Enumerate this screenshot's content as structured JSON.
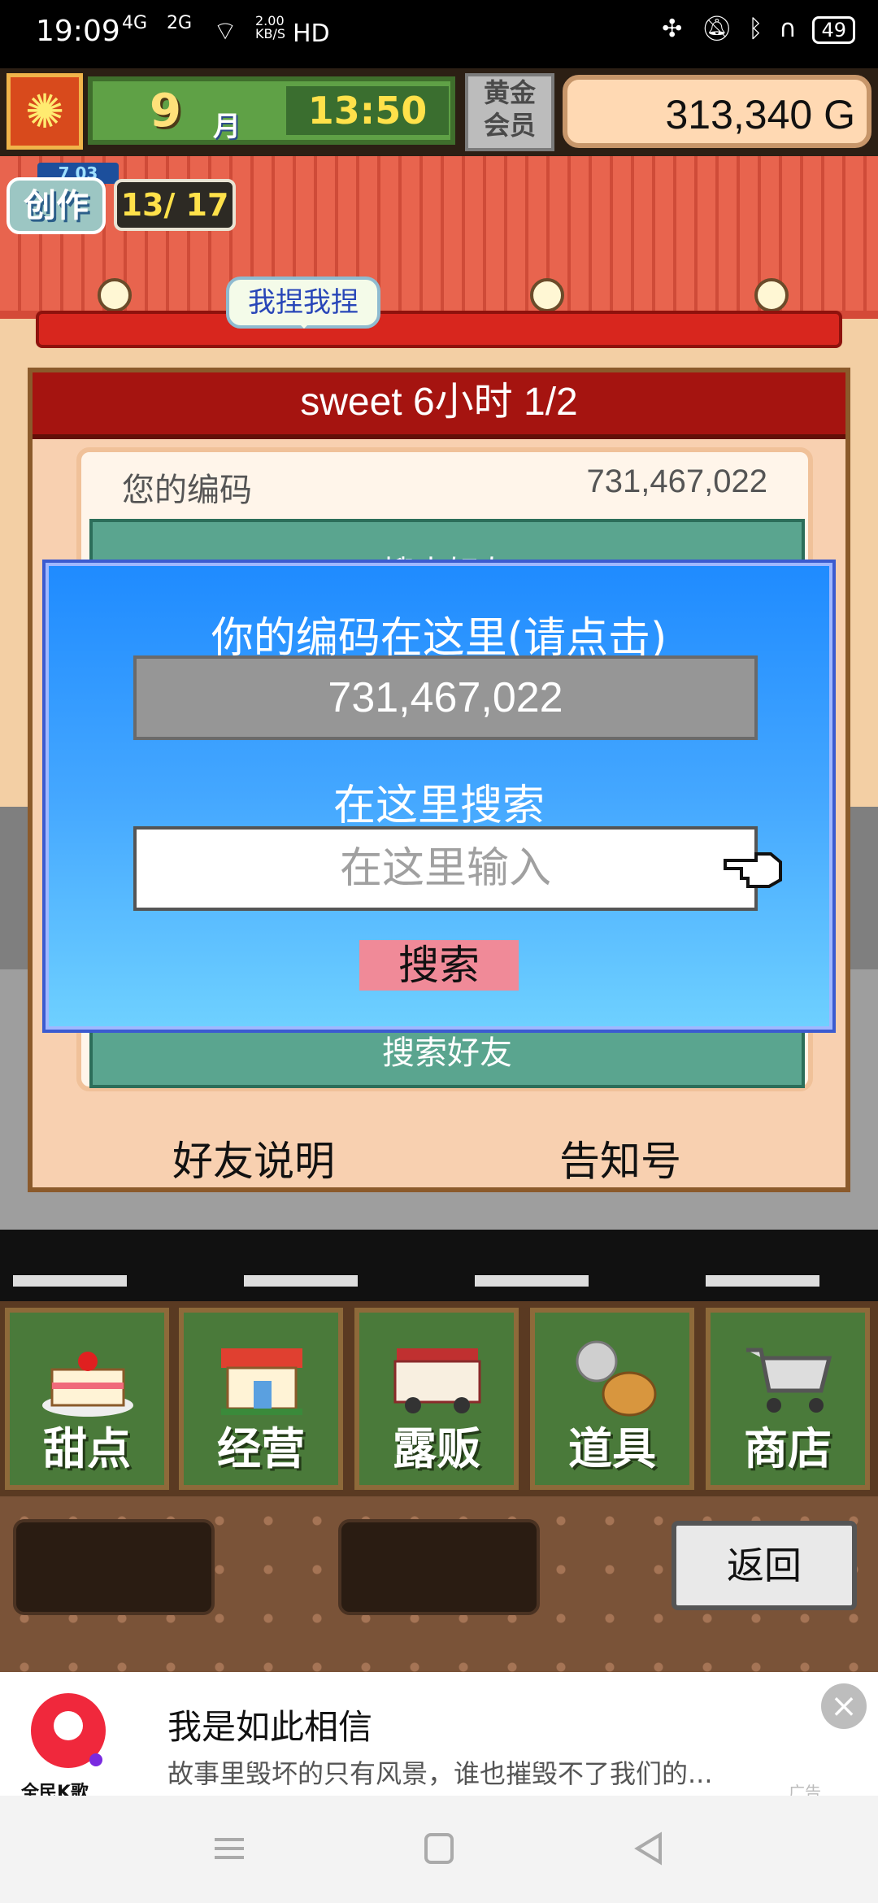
{
  "status_bar": {
    "time": "19:09",
    "signal_1": "4G",
    "signal_2": "2G",
    "speed": "2.00 KB/S",
    "hd": "HD",
    "battery": "49"
  },
  "hud": {
    "month_number": "9",
    "month_label": "月",
    "clock": "13:50",
    "gold_member": "黄金\n会员",
    "money": "313,340 G"
  },
  "create_badge": {
    "level": "7 03",
    "label": "创作",
    "count": "13/ 17"
  },
  "speech_bubble": "我捏我捏",
  "friend_panel": {
    "title": "sweet  6小时 1/2",
    "code_label": "您的编码",
    "code_value": "731,467,022",
    "search_friend": "搜索好友",
    "friend_info_link": "好友说明",
    "notice_link": "告知号"
  },
  "dialog": {
    "title": "你的编码在这里(请点击)",
    "code": "731,467,022",
    "search_label": "在这里搜索",
    "input_placeholder": "在这里输入",
    "search_button": "搜索"
  },
  "menu": {
    "items": [
      {
        "label": "甜点",
        "icon": "cake-icon"
      },
      {
        "label": "经营",
        "icon": "shop-icon"
      },
      {
        "label": "露贩",
        "icon": "food-truck-icon"
      },
      {
        "label": "道具",
        "icon": "items-bag-icon"
      },
      {
        "label": "商店",
        "icon": "cart-icon"
      }
    ],
    "return_button": "返回"
  },
  "ad": {
    "logo_text": "全民K歌",
    "title": "我是如此相信",
    "desc": "故事里毁坏的只有风景，谁也摧毁不了我们的...",
    "tag": "广告"
  },
  "colors": {
    "dialog_blue": "#1f8bff",
    "panel_red": "#a51410",
    "search_button": "#f08a98",
    "teal": "#5aa58f"
  }
}
